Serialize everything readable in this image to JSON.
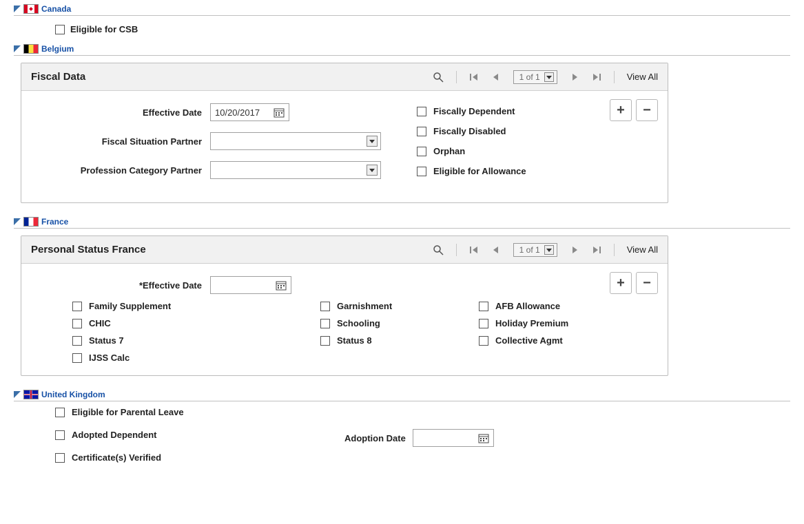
{
  "sections": {
    "canada": {
      "title": "Canada",
      "checkboxes": {
        "eligible_csb": "Eligible for CSB"
      }
    },
    "belgium": {
      "title": "Belgium"
    },
    "france": {
      "title": "France"
    },
    "uk": {
      "title": "United Kingdom"
    }
  },
  "fiscal_panel": {
    "title": "Fiscal Data",
    "pager": "1 of 1",
    "view_all": "View All",
    "labels": {
      "effective_date": "Effective Date",
      "fiscal_situation_partner": "Fiscal Situation Partner",
      "profession_category_partner": "Profession Category Partner"
    },
    "values": {
      "effective_date": "10/20/2017"
    },
    "checkboxes": {
      "fiscally_dependent": "Fiscally Dependent",
      "fiscally_disabled": "Fiscally Disabled",
      "orphan": "Orphan",
      "eligible_allowance": "Eligible for Allowance"
    }
  },
  "france_panel": {
    "title": "Personal Status France",
    "pager": "1 of 1",
    "view_all": "View All",
    "labels": {
      "effective_date": "*Effective Date"
    },
    "checkboxes": {
      "family_supplement": "Family Supplement",
      "chic": "CHIC",
      "status7": "Status 7",
      "ijss_calc": "IJSS Calc",
      "garnishment": "Garnishment",
      "schooling": "Schooling",
      "status8": "Status 8",
      "afb_allowance": "AFB Allowance",
      "holiday_premium": "Holiday Premium",
      "collective_agmt": "Collective Agmt"
    }
  },
  "uk_block": {
    "labels": {
      "adoption_date": "Adoption Date"
    },
    "checkboxes": {
      "eligible_parental_leave": "Eligible for Parental Leave",
      "adopted_dependent": "Adopted Dependent",
      "certificates_verified": "Certificate(s) Verified"
    }
  }
}
